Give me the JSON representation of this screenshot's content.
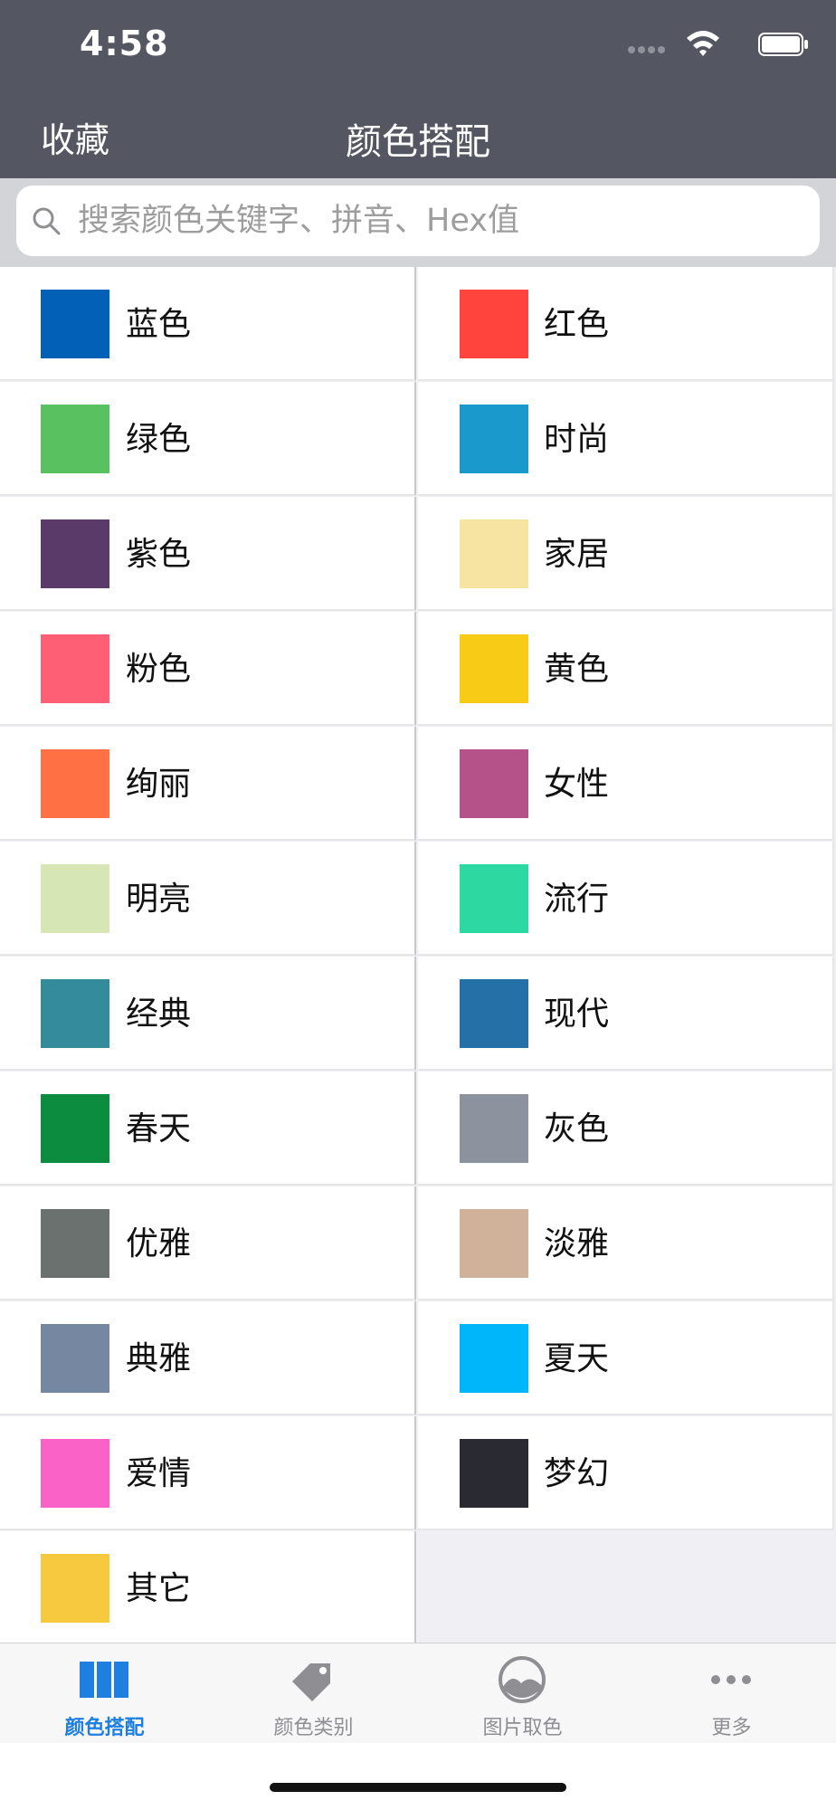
{
  "status_bar": {
    "time": "4:58"
  },
  "nav": {
    "left_button": "收藏",
    "title": "颜色搭配"
  },
  "search": {
    "placeholder": "搜索颜色关键字、拼音、Hex值"
  },
  "categories": [
    {
      "label": "蓝色",
      "color": "#0260b7"
    },
    {
      "label": "红色",
      "color": "#ff443d"
    },
    {
      "label": "绿色",
      "color": "#59c15f"
    },
    {
      "label": "时尚",
      "color": "#1a99cc"
    },
    {
      "label": "紫色",
      "color": "#5a3a68"
    },
    {
      "label": "家居",
      "color": "#f7e3a2"
    },
    {
      "label": "粉色",
      "color": "#ff5f74"
    },
    {
      "label": "黄色",
      "color": "#f8cb16"
    },
    {
      "label": "绚丽",
      "color": "#ff7044"
    },
    {
      "label": "女性",
      "color": "#b5528a"
    },
    {
      "label": "明亮",
      "color": "#d6e6b4"
    },
    {
      "label": "流行",
      "color": "#2dd9a0"
    },
    {
      "label": "经典",
      "color": "#338b9c"
    },
    {
      "label": "现代",
      "color": "#2670a8"
    },
    {
      "label": "春天",
      "color": "#0b8c3f"
    },
    {
      "label": "灰色",
      "color": "#8c929e"
    },
    {
      "label": "优雅",
      "color": "#6b716e"
    },
    {
      "label": "淡雅",
      "color": "#cfb299"
    },
    {
      "label": "典雅",
      "color": "#7687a1"
    },
    {
      "label": "夏天",
      "color": "#00b6fb"
    },
    {
      "label": "爱情",
      "color": "#fb62c8"
    },
    {
      "label": "梦幻",
      "color": "#292a32"
    },
    {
      "label": "其它",
      "color": "#f7c93f"
    }
  ],
  "tabbar": {
    "tabs": [
      {
        "label": "颜色搭配",
        "icon": "columns-icon",
        "active": true
      },
      {
        "label": "颜色类别",
        "icon": "tag-icon",
        "active": false
      },
      {
        "label": "图片取色",
        "icon": "image-icon",
        "active": false
      },
      {
        "label": "更多",
        "icon": "more-icon",
        "active": false
      }
    ]
  }
}
